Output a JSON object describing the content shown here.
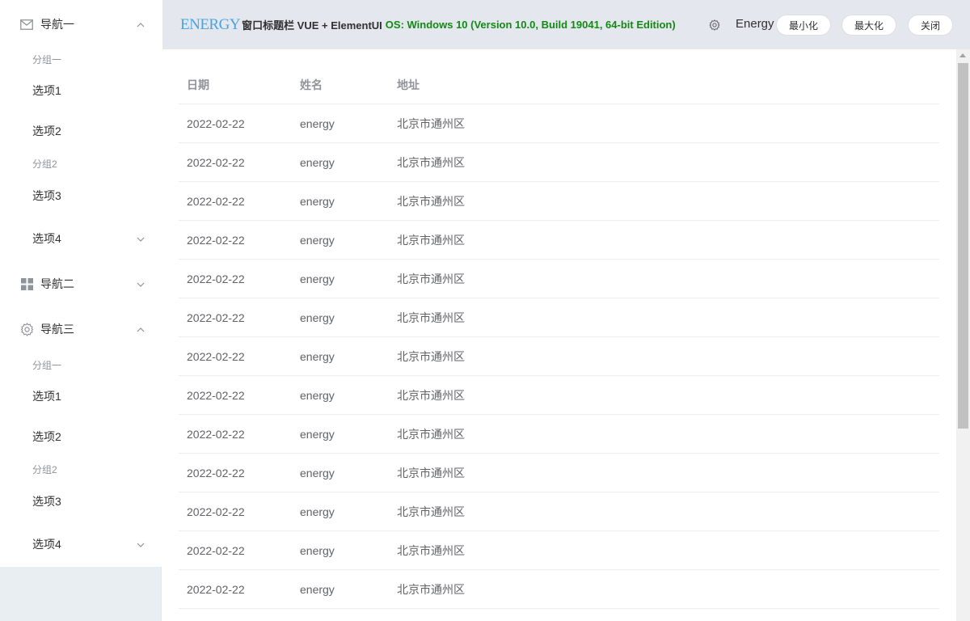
{
  "header": {
    "logo": "ENERGY",
    "title": "窗口标题栏 VUE + ElementUI",
    "os_info": "OS: Windows 10 (Version 10.0, Build 19041, 64-bit Edition)",
    "brand": "Energy",
    "minimize_label": "最小化",
    "maximize_label": "最大化",
    "close_label": "关闭"
  },
  "sidebar": {
    "nav1": {
      "label": "导航一",
      "group1": "分组一",
      "item1": "选项1",
      "item2": "选项2",
      "group2": "分组2",
      "item3": "选项3",
      "item4": "选项4"
    },
    "nav2": {
      "label": "导航二"
    },
    "nav3": {
      "label": "导航三",
      "group1": "分组一",
      "item1": "选项1",
      "item2": "选项2",
      "group2": "分组2",
      "item3": "选项3",
      "item4": "选项4"
    }
  },
  "table": {
    "columns": [
      "日期",
      "姓名",
      "地址"
    ],
    "rows": [
      [
        "2022-02-22",
        "energy",
        "北京市通州区"
      ],
      [
        "2022-02-22",
        "energy",
        "北京市通州区"
      ],
      [
        "2022-02-22",
        "energy",
        "北京市通州区"
      ],
      [
        "2022-02-22",
        "energy",
        "北京市通州区"
      ],
      [
        "2022-02-22",
        "energy",
        "北京市通州区"
      ],
      [
        "2022-02-22",
        "energy",
        "北京市通州区"
      ],
      [
        "2022-02-22",
        "energy",
        "北京市通州区"
      ],
      [
        "2022-02-22",
        "energy",
        "北京市通州区"
      ],
      [
        "2022-02-22",
        "energy",
        "北京市通州区"
      ],
      [
        "2022-02-22",
        "energy",
        "北京市通州区"
      ],
      [
        "2022-02-22",
        "energy",
        "北京市通州区"
      ],
      [
        "2022-02-22",
        "energy",
        "北京市通州区"
      ],
      [
        "2022-02-22",
        "energy",
        "北京市通州区"
      ]
    ]
  },
  "colors": {
    "header_bg": "#e4e7ed",
    "os_text": "#138a13",
    "logo": "#4aa3df",
    "aside_bg": "#e9eef3"
  }
}
